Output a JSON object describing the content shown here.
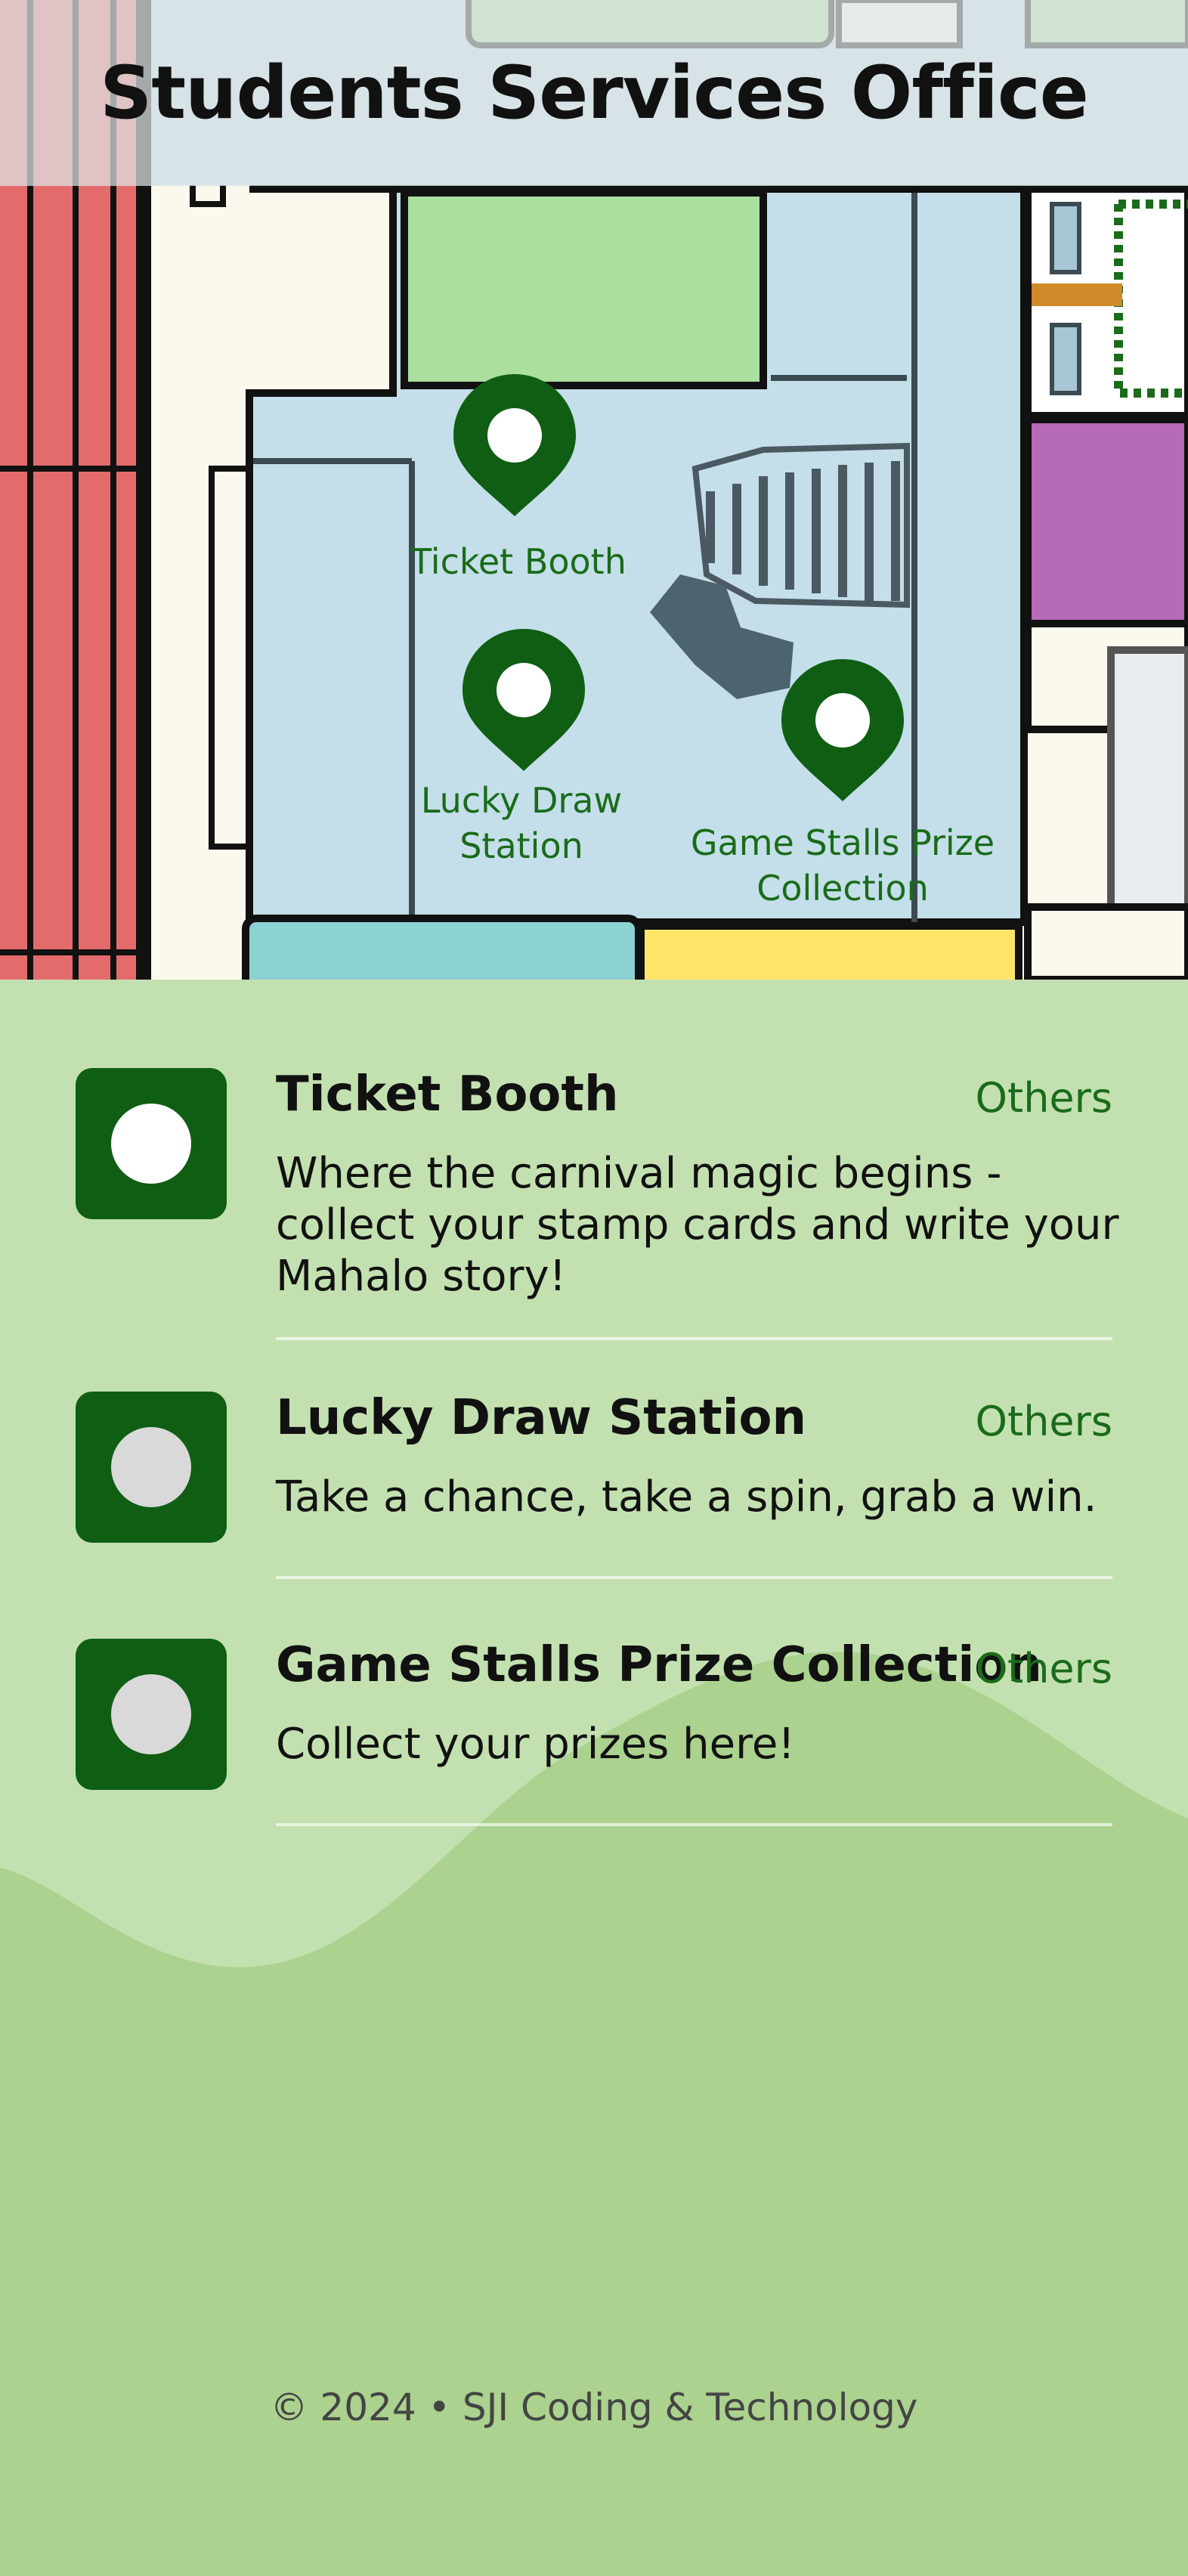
{
  "header": {
    "title": "Students Services Office"
  },
  "map": {
    "pins": [
      {
        "label": "Ticket Booth"
      },
      {
        "label": "Lucky Draw Station"
      },
      {
        "label": "Game Stalls Prize Collection"
      }
    ]
  },
  "locations": [
    {
      "title": "Ticket Booth",
      "category": "Others",
      "description": "Where the carnival magic begins - collect your stamp cards and write your Mahalo story!",
      "thumb_dot_color": "#ffffff"
    },
    {
      "title": "Lucky Draw Station",
      "category": "Others",
      "description": "Take a chance, take a spin, grab a win.",
      "thumb_dot_color": "#d9d9d9"
    },
    {
      "title": "Game Stalls Prize Collection",
      "category": "Others",
      "description": "Collect your prizes here!",
      "thumb_dot_color": "#d9d9d9"
    }
  ],
  "footer": {
    "text": "© 2024 • SJI Coding & Technology"
  },
  "colors": {
    "accent_green": "#0f5e14",
    "label_green": "#1a6b1a",
    "panel_green": "#abd28e",
    "panel_light": "#c3e1b0"
  }
}
